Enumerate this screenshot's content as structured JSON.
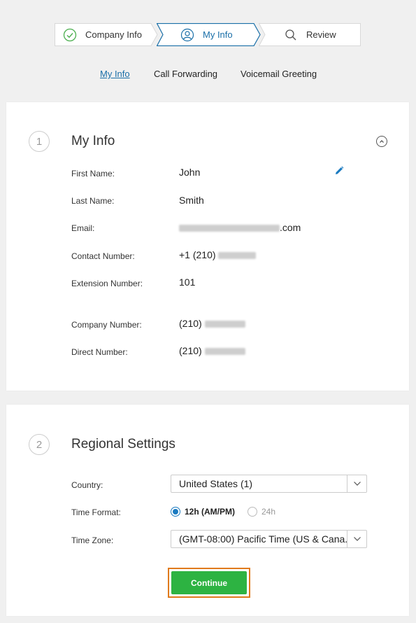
{
  "stepper": {
    "steps": [
      {
        "label": "Company Info",
        "icon": "check-circle-icon",
        "state": "done"
      },
      {
        "label": "My Info",
        "icon": "user-icon",
        "state": "active"
      },
      {
        "label": "Review",
        "icon": "search-icon",
        "state": "upcoming"
      }
    ]
  },
  "subtabs": [
    {
      "label": "My Info",
      "active": true
    },
    {
      "label": "Call Forwarding",
      "active": false
    },
    {
      "label": "Voicemail Greeting",
      "active": false
    }
  ],
  "my_info": {
    "number": "1",
    "title": "My Info",
    "first_name_label": "First Name:",
    "first_name": "John",
    "last_name_label": "Last Name:",
    "last_name": "Smith",
    "email_label": "Email:",
    "email_suffix": ".com",
    "contact_label": "Contact Number:",
    "contact_prefix": "+1 (210)",
    "extension_label": "Extension Number:",
    "extension": "101",
    "company_label": "Company Number:",
    "company_prefix": "(210)",
    "direct_label": "Direct Number:",
    "direct_prefix": "(210)"
  },
  "regional": {
    "number": "2",
    "title": "Regional Settings",
    "country_label": "Country:",
    "country_value": "United States (1)",
    "time_format_label": "Time Format:",
    "time_format_option_1": "12h (AM/PM)",
    "time_format_option_2": "24h",
    "time_format_selected": "12h (AM/PM)",
    "time_zone_label": "Time Zone:",
    "time_zone_value": "(GMT-08:00) Pacific Time (US & Cana..."
  },
  "continue_label": "Continue",
  "colors": {
    "accent": "#1a6fa8",
    "continue_button": "#2db342",
    "highlight": "#e07a1c"
  }
}
